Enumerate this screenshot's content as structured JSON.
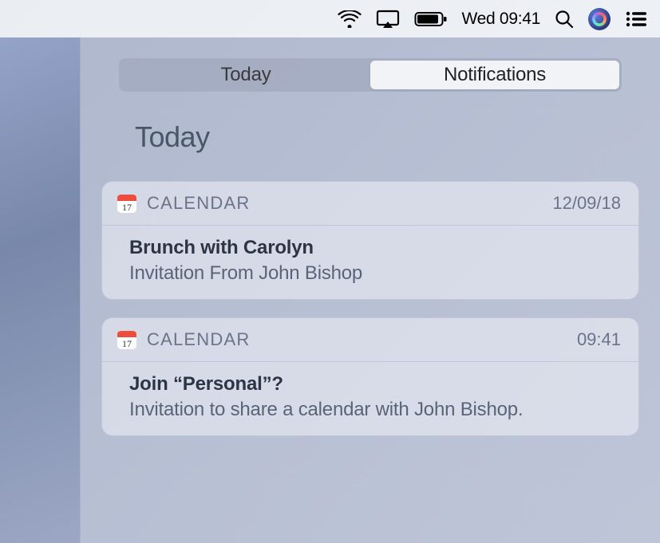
{
  "menubar": {
    "datetime": "Wed 09:41"
  },
  "nc": {
    "tabs": {
      "today": "Today",
      "notifications": "Notifications"
    },
    "section_title": "Today",
    "items": [
      {
        "app": "CALENDAR",
        "timestamp": "12/09/18",
        "title": "Brunch with Carolyn",
        "subtitle": "Invitation From John Bishop"
      },
      {
        "app": "CALENDAR",
        "timestamp": "09:41",
        "title": "Join “Personal”?",
        "subtitle": "Invitation to share a calendar with John Bishop."
      }
    ]
  }
}
